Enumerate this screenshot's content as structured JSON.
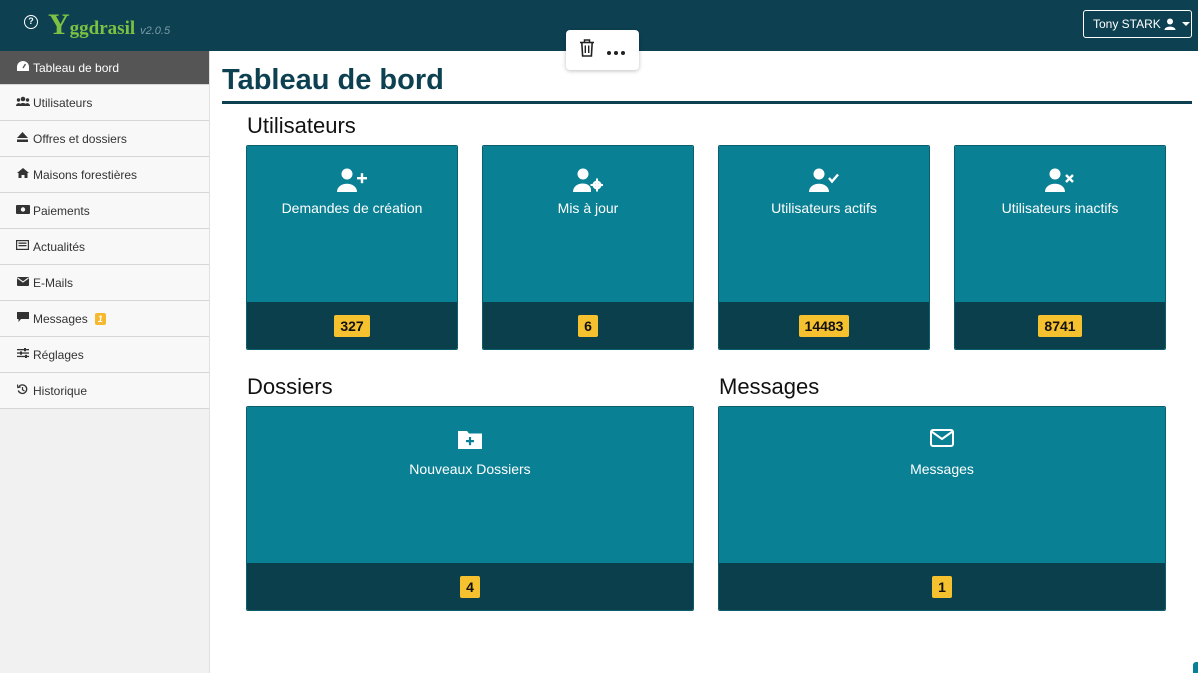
{
  "header": {
    "help_icon": "?",
    "logo_y": "Y",
    "logo_text": "ggdrasil",
    "version": "v2.0.5",
    "user_name": "Tony STARK"
  },
  "sidebar": {
    "items": [
      {
        "label": "Tableau de bord",
        "icon": "dashboard-icon"
      },
      {
        "label": "Utilisateurs",
        "icon": "users-icon"
      },
      {
        "label": "Offres et dossiers",
        "icon": "eject-icon"
      },
      {
        "label": "Maisons forestières",
        "icon": "home-icon"
      },
      {
        "label": "Paiements",
        "icon": "money-icon"
      },
      {
        "label": "Actualités",
        "icon": "newspaper-icon"
      },
      {
        "label": "E-Mails",
        "icon": "envelope-icon"
      },
      {
        "label": "Messages",
        "icon": "comment-icon",
        "badge": "1"
      },
      {
        "label": "Réglages",
        "icon": "sliders-icon"
      },
      {
        "label": "Historique",
        "icon": "history-icon"
      }
    ]
  },
  "main": {
    "title": "Tableau de bord",
    "sections": {
      "users": "Utilisateurs",
      "dossiers": "Dossiers",
      "messages": "Messages"
    },
    "cards": {
      "creation": {
        "label": "Demandes de création",
        "count": "327"
      },
      "update": {
        "label": "Mis à jour",
        "count": "6"
      },
      "active": {
        "label": "Utilisateurs actifs",
        "count": "14483"
      },
      "inactive": {
        "label": "Utilisateurs inactifs",
        "count": "8741"
      },
      "new_dossiers": {
        "label": "Nouveaux Dossiers",
        "count": "4"
      },
      "messages": {
        "label": "Messages",
        "count": "1"
      }
    }
  },
  "colors": {
    "header_bg": "#0d4152",
    "card_top": "#0a8094",
    "card_bottom": "#0b3f4b",
    "badge": "#f5c12e"
  }
}
